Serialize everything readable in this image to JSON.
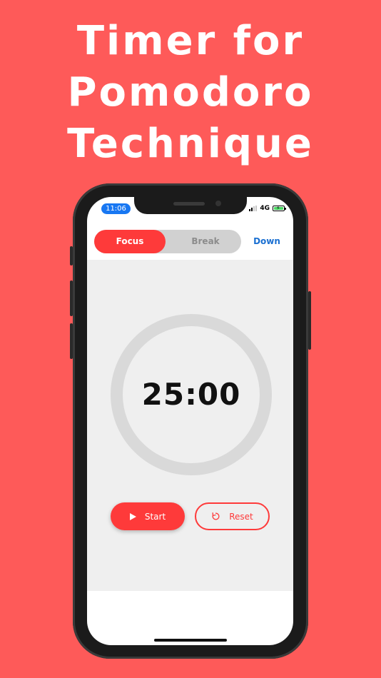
{
  "headline": {
    "lines": [
      "Timer for",
      "Pomodoro",
      "Technique"
    ]
  },
  "status_bar": {
    "time": "11:06",
    "network": "4G",
    "battery_icon": "battery-charging-icon"
  },
  "mode": {
    "focus_label": "Focus",
    "break_label": "Break",
    "selected": "Focus",
    "direction_label": "Down"
  },
  "timer": {
    "display": "25:00",
    "progress": 0
  },
  "controls": {
    "start_label": "Start",
    "reset_label": "Reset"
  },
  "colors": {
    "background": "#fe5a59",
    "accent": "#fe3a3a",
    "link": "#1a6fd1",
    "ring": "#d9d9d9",
    "panel": "#efefef"
  }
}
